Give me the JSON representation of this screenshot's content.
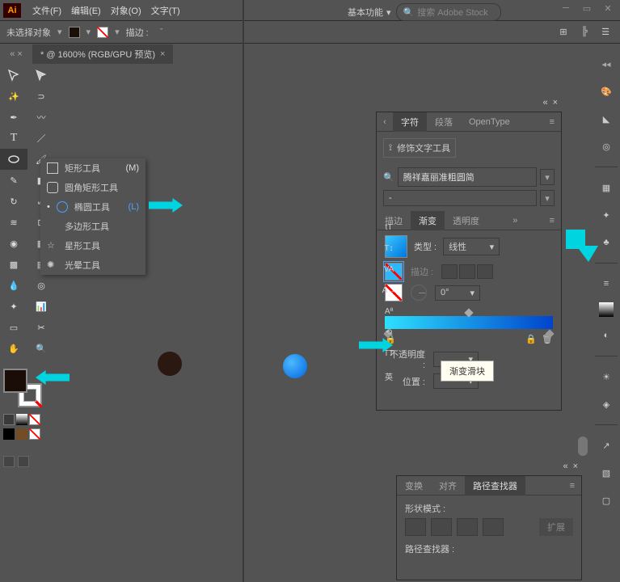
{
  "menu": {
    "file": "文件(F)",
    "edit": "编辑(E)",
    "object": "对象(O)",
    "type": "文字(T)"
  },
  "workspace": "基本功能",
  "search_placeholder": "搜索 Adobe Stock",
  "controlbar": {
    "no_selection": "未选择对象",
    "stroke_label": "描边 :"
  },
  "doc_tab": "* @ 1600% (RGB/GPU 预览)",
  "flyout": {
    "rect": {
      "label": "矩形工具",
      "shortcut": "(M)"
    },
    "rrect": {
      "label": "圆角矩形工具"
    },
    "ellipse": {
      "label": "椭圆工具",
      "shortcut": "(L)"
    },
    "poly": {
      "label": "多边形工具"
    },
    "star": {
      "label": "星形工具"
    },
    "flare": {
      "label": "光晕工具"
    }
  },
  "char_panel": {
    "tab_char": "字符",
    "tab_para": "段落",
    "tab_ot": "OpenType",
    "touch": "修饰文字工具",
    "font": "腾祥嘉丽准粗圆简",
    "weight": "-",
    "sub_stroke": "描边",
    "sub_grad": "渐变",
    "sub_trans": "透明度",
    "type_lbl": "类型 :",
    "type_val": "线性",
    "stroke_lbl": "描边 :",
    "angle_val": "0°",
    "tooltip": "渐变滑块",
    "opacity_lbl": "不透明度 :",
    "pos_lbl": "位置 :",
    "lang_prefix": "英"
  },
  "pathfinder": {
    "tab_transform": "变换",
    "tab_align": "对齐",
    "tab_path": "路径查找器",
    "shape_modes": "形状模式 :",
    "expand": "扩展",
    "pathfinders": "路径查找器 :"
  }
}
